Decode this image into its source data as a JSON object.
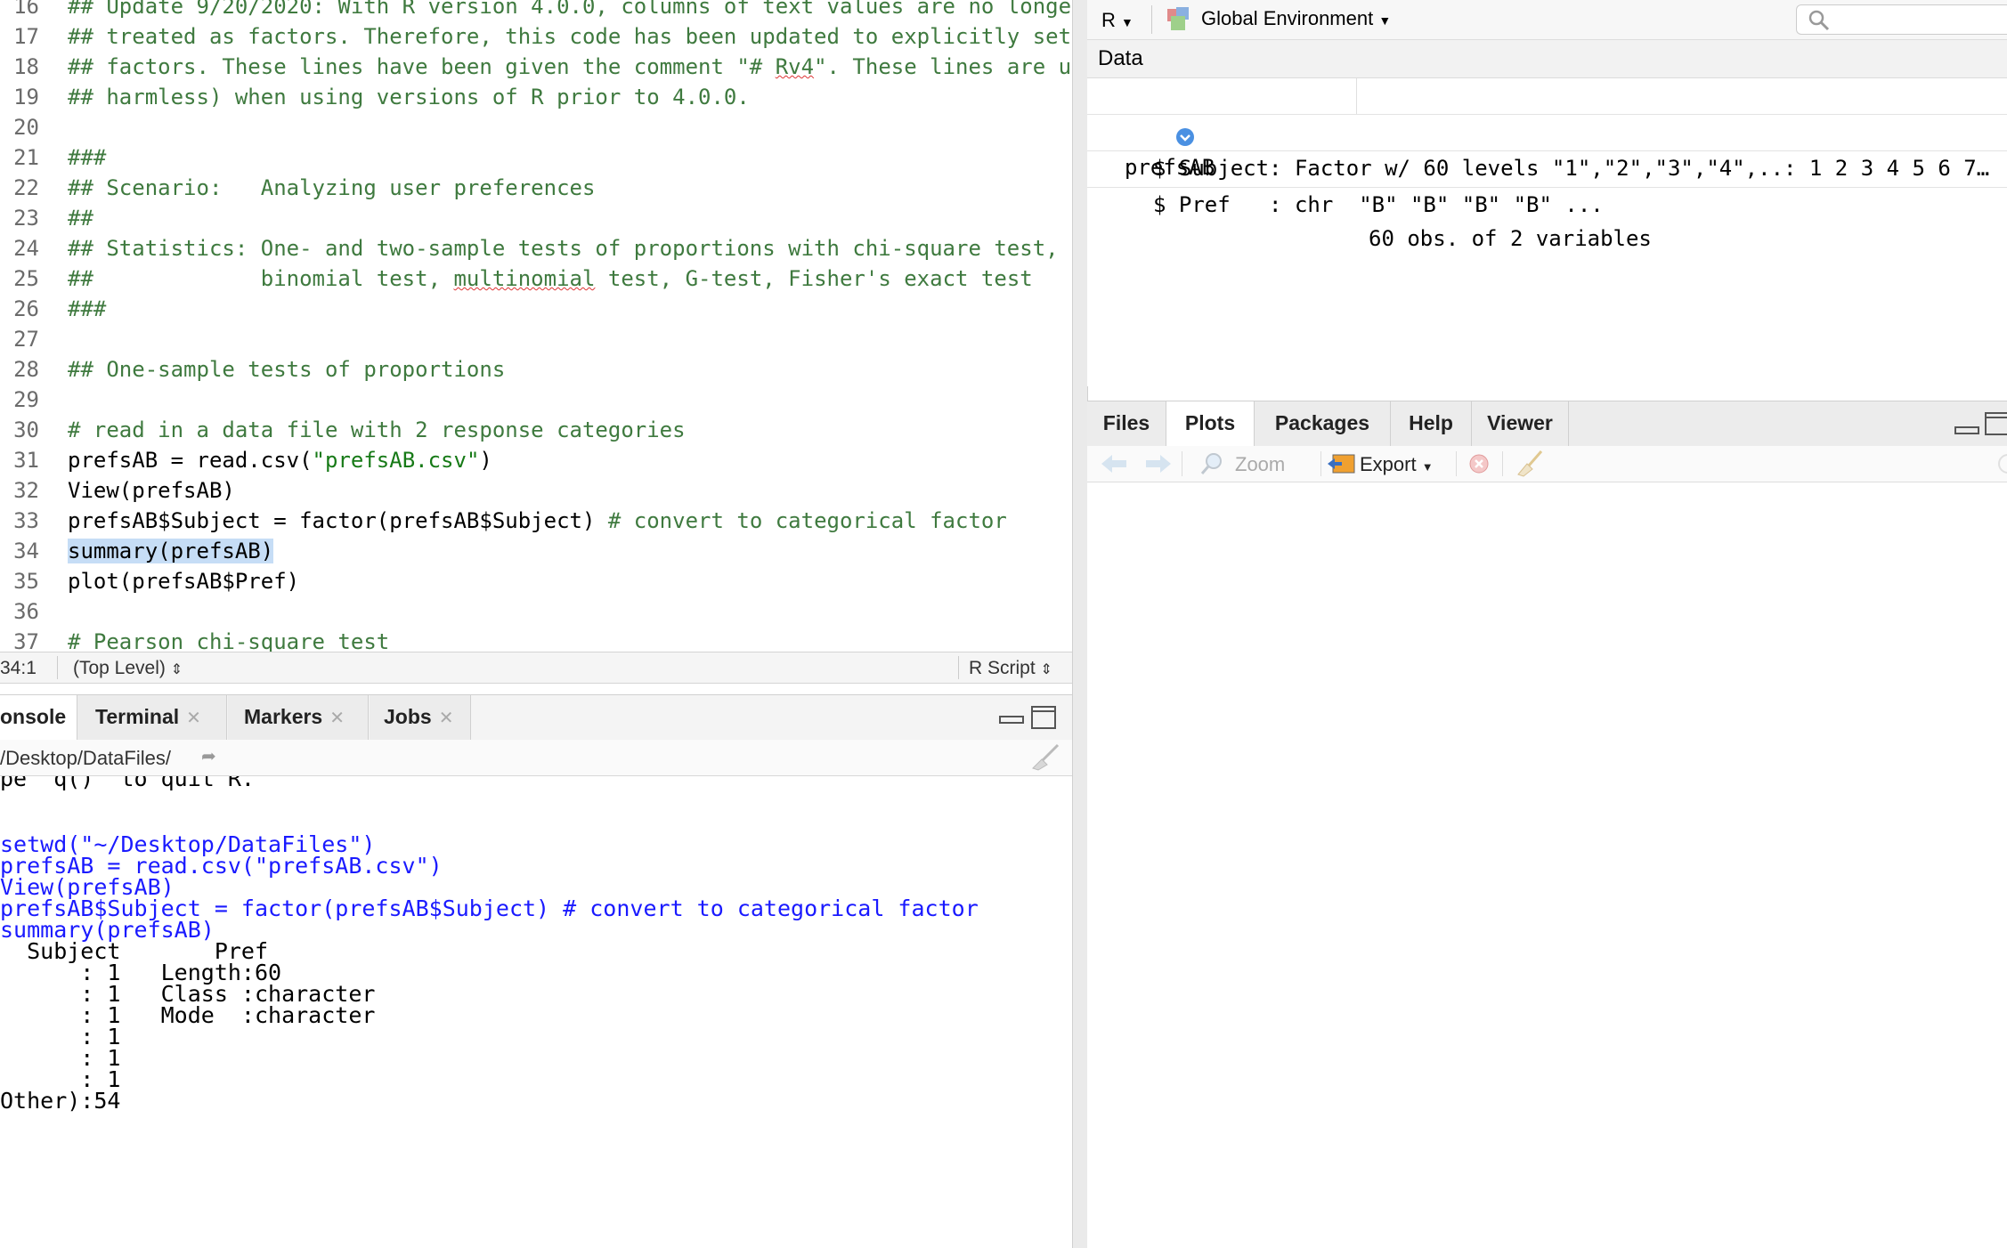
{
  "editor": {
    "lines": [
      {
        "num": "16",
        "parts": [
          {
            "t": "## Update 9/20/2020: With R version 4.0.0, columns of text values are no longe",
            "c": "cmt"
          }
        ]
      },
      {
        "num": "17",
        "parts": [
          {
            "t": "## treated as factors. Therefore, this code has been updated to explicitly set",
            "c": "cmt"
          }
        ]
      },
      {
        "num": "18",
        "parts": [
          {
            "t": "## factors. These lines have been given the comment \"# Rv4\". These lines are u",
            "c": "cmt"
          }
        ]
      },
      {
        "num": "19",
        "parts": [
          {
            "t": "## harmless) when using versions of R prior to 4.0.0.",
            "c": "cmt"
          }
        ]
      },
      {
        "num": "20",
        "parts": []
      },
      {
        "num": "21",
        "parts": [
          {
            "t": "###",
            "c": "cmt"
          }
        ]
      },
      {
        "num": "22",
        "parts": [
          {
            "t": "## Scenario:   Analyzing user preferences",
            "c": "cmt"
          }
        ]
      },
      {
        "num": "23",
        "parts": [
          {
            "t": "##",
            "c": "cmt"
          }
        ]
      },
      {
        "num": "24",
        "parts": [
          {
            "t": "## Statistics: One- and two-sample tests of proportions with chi-square test,",
            "c": "cmt"
          }
        ]
      },
      {
        "num": "25",
        "parts": [
          {
            "t": "##             binomial test, multinomial test, G-test, Fisher's exact test",
            "c": "cmt"
          }
        ]
      },
      {
        "num": "26",
        "parts": [
          {
            "t": "###",
            "c": "cmt"
          }
        ]
      },
      {
        "num": "27",
        "parts": []
      },
      {
        "num": "28",
        "parts": [
          {
            "t": "## One-sample tests of proportions",
            "c": "cmt"
          }
        ]
      },
      {
        "num": "29",
        "parts": []
      },
      {
        "num": "30",
        "parts": [
          {
            "t": "# read in a data file with 2 response categories",
            "c": "cmt"
          }
        ]
      },
      {
        "num": "31",
        "parts": [
          {
            "t": "prefsAB = read.csv(",
            "c": ""
          },
          {
            "t": "\"prefsAB.csv\"",
            "c": "str"
          },
          {
            "t": ")",
            "c": ""
          }
        ]
      },
      {
        "num": "32",
        "parts": [
          {
            "t": "View(prefsAB)",
            "c": ""
          }
        ]
      },
      {
        "num": "33",
        "parts": [
          {
            "t": "prefsAB$Subject = factor(prefsAB$Subject) ",
            "c": ""
          },
          {
            "t": "# convert to categorical factor",
            "c": "cmt"
          }
        ]
      },
      {
        "num": "34",
        "parts": [
          {
            "t": "summary(prefsAB)",
            "c": "sel"
          }
        ]
      },
      {
        "num": "35",
        "parts": [
          {
            "t": "plot(prefsAB$Pref)",
            "c": ""
          }
        ]
      },
      {
        "num": "36",
        "parts": []
      },
      {
        "num": "37",
        "parts": [
          {
            "t": "# Pearson chi-square test",
            "c": "cmt"
          }
        ]
      }
    ],
    "status": {
      "position": "34:1",
      "scope": "(Top Level)",
      "filetype": "R Script"
    }
  },
  "console": {
    "tabs": [
      {
        "label": "onsole",
        "closable": false,
        "active": true
      },
      {
        "label": "Terminal",
        "closable": true,
        "active": false
      },
      {
        "label": "Markers",
        "closable": true,
        "active": false
      },
      {
        "label": "Jobs",
        "closable": true,
        "active": false
      }
    ],
    "path": "/Desktop/DataFiles/",
    "lines": [
      {
        "t": "pe 'q()' to quit R.",
        "c": "con-out",
        "cut": true
      },
      {
        "t": "",
        "c": "con-out"
      },
      {
        "t": "setwd(\"~/Desktop/DataFiles\")",
        "c": "con-in"
      },
      {
        "t": "prefsAB = read.csv(\"prefsAB.csv\")",
        "c": "con-in"
      },
      {
        "t": "View(prefsAB)",
        "c": "con-in"
      },
      {
        "t": "prefsAB$Subject = factor(prefsAB$Subject) # convert to categorical factor",
        "c": "con-in"
      },
      {
        "t": "summary(prefsAB)",
        "c": "con-in"
      },
      {
        "t": "  Subject       Pref          ",
        "c": "con-out"
      },
      {
        "t": "      : 1   Length:60         ",
        "c": "con-out"
      },
      {
        "t": "      : 1   Class :character  ",
        "c": "con-out"
      },
      {
        "t": "      : 1   Mode  :character  ",
        "c": "con-out"
      },
      {
        "t": "      : 1                     ",
        "c": "con-out"
      },
      {
        "t": "      : 1                     ",
        "c": "con-out"
      },
      {
        "t": "      : 1                     ",
        "c": "con-out"
      },
      {
        "t": "Other):54                     ",
        "c": "con-out"
      }
    ]
  },
  "environment": {
    "language": "R",
    "scope": "Global Environment",
    "section": "Data",
    "object_name": "prefsAB",
    "object_summary": "60 obs. of 2 variables",
    "details": [
      "$ Subject: Factor w/ 60 levels \"1\",\"2\",\"3\",\"4\",..: 1 2 3 4 5 6 7…",
      "$ Pref   : chr  \"B\" \"B\" \"B\" \"B\" ..."
    ]
  },
  "files_pane": {
    "tabs": [
      {
        "label": "Files",
        "active": false
      },
      {
        "label": "Plots",
        "active": true
      },
      {
        "label": "Packages",
        "active": false
      },
      {
        "label": "Help",
        "active": false
      },
      {
        "label": "Viewer",
        "active": false
      }
    ],
    "toolbar": {
      "zoom": "Zoom",
      "export": "Export"
    }
  }
}
